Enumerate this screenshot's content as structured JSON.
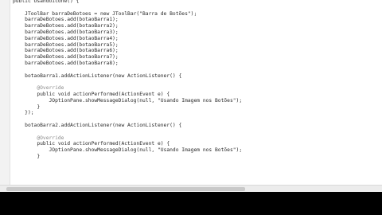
{
  "editor": {
    "lines": [
      {
        "text": "public Usandoicone() {",
        "cls": "kw"
      },
      {
        "text": "",
        "cls": ""
      },
      {
        "text": "    JToolBar barraDeBotoes = new JToolBar(\"Barra de Botões\");",
        "cls": ""
      },
      {
        "text": "    barraDeBotoes.add(botaoBarra1);",
        "cls": ""
      },
      {
        "text": "    barraDeBotoes.add(botaoBarra2);",
        "cls": ""
      },
      {
        "text": "    barraDeBotoes.add(botaoBarra3);",
        "cls": ""
      },
      {
        "text": "    barraDeBotoes.add(botaoBarra4);",
        "cls": ""
      },
      {
        "text": "    barraDeBotoes.add(botaoBarra5);",
        "cls": ""
      },
      {
        "text": "    barraDeBotoes.add(botaoBarra6);",
        "cls": ""
      },
      {
        "text": "    barraDeBotoes.add(botaoBarra7);",
        "cls": ""
      },
      {
        "text": "    barraDeBotoes.add(botaoBarra8);",
        "cls": ""
      },
      {
        "text": "",
        "cls": ""
      },
      {
        "text": "    botaoBarra1.addActionListener(new ActionListener() {",
        "cls": ""
      },
      {
        "text": "",
        "cls": ""
      },
      {
        "text": "        @Override",
        "cls": "ann"
      },
      {
        "text": "        public void actionPerformed(ActionEvent e) {",
        "cls": ""
      },
      {
        "text": "            JOptionPane.showMessageDialog(null, \"Usando Imagem nos Botões\");",
        "cls": ""
      },
      {
        "text": "        }",
        "cls": ""
      },
      {
        "text": "    });",
        "cls": ""
      },
      {
        "text": "",
        "cls": ""
      },
      {
        "text": "    botaoBarra2.addActionListener(new ActionListener() {",
        "cls": ""
      },
      {
        "text": "",
        "cls": ""
      },
      {
        "text": "        @Override",
        "cls": "ann"
      },
      {
        "text": "        public void actionPerformed(ActionEvent e) {",
        "cls": ""
      },
      {
        "text": "            JOptionPane.showMessageDialog(null, \"Usando Imagem nos Botões\");",
        "cls": ""
      },
      {
        "text": "        }",
        "cls": ""
      }
    ]
  }
}
